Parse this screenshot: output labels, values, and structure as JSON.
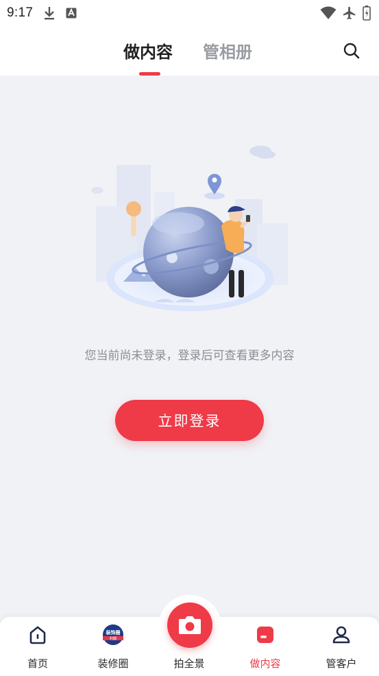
{
  "status_bar": {
    "time": "9:17",
    "icons": [
      "download-icon",
      "translate-icon",
      "wifi-icon",
      "airplane-icon",
      "battery-icon"
    ]
  },
  "header": {
    "tabs": [
      {
        "label": "做内容",
        "active": true
      },
      {
        "label": "管相册",
        "active": false
      }
    ],
    "search_icon": "search-icon"
  },
  "main": {
    "empty_message": "您当前尚未登录，登录后可查看更多内容",
    "login_button": "立即登录"
  },
  "bottom_nav": {
    "items": [
      {
        "label": "首页",
        "icon": "home-icon",
        "active": false
      },
      {
        "label": "装修圈",
        "icon": "decoration-circle-logo",
        "active": false
      },
      {
        "label": "拍全景",
        "icon": "camera-icon",
        "active": false
      },
      {
        "label": "做内容",
        "icon": "content-card-icon",
        "active": true
      },
      {
        "label": "管客户",
        "icon": "user-icon",
        "active": false
      }
    ],
    "logo_text": {
      "top": "装饰圈",
      "bottom": "利器"
    }
  },
  "colors": {
    "accent": "#ef3a48",
    "background": "#f1f2f6",
    "text_primary": "#1f1f1f",
    "text_inactive": "#9a9ca3",
    "text_secondary": "#8a8d95"
  }
}
